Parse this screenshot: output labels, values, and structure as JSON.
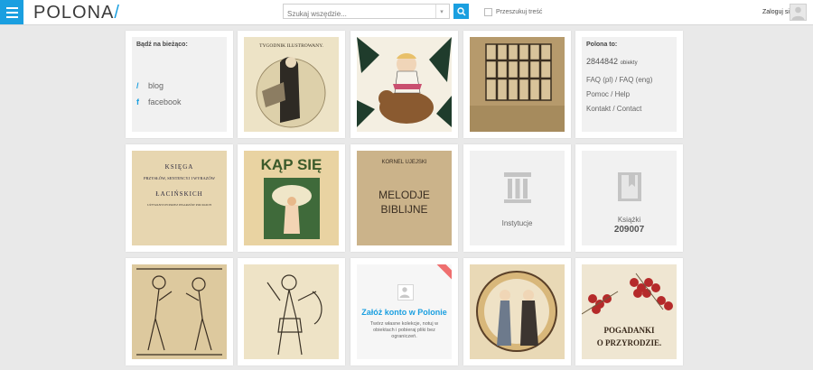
{
  "header": {
    "logo_text": "POLONA",
    "logo_slash": "/",
    "search_placeholder": "Szukaj wszędzie...",
    "fulltext_label": "Przeszukuj treść",
    "login_label": "Zaloguj się"
  },
  "current_panel": {
    "title": "Bądź na bieżąco:",
    "blog_label": "blog",
    "facebook_label": "facebook"
  },
  "polona_panel": {
    "title": "Polona to:",
    "objects_count": "2844842",
    "objects_label": "obiekty",
    "links": [
      "FAQ (pl) / FAQ (eng)",
      "Pomoc / Help",
      "Kontakt / Contact"
    ]
  },
  "categories": {
    "institutions_label": "Instytucje",
    "books_label": "Książki",
    "books_count": "209007"
  },
  "promo": {
    "title": "Załóż konto w Polonie",
    "text": "Twórz własne kolekcje, notuj w obiektach i pobieraj pliki bez ograniczeń."
  },
  "covers": {
    "tygodnik": "TYGODNIK ILUSTROWANY.",
    "ksiega_lines": [
      "KSIĘGA",
      "PRZYSŁÓW, SENTENCYJ I WYRAZÓW",
      "ŁACIŃSKICH",
      "UŻYWANYCH PRZEZ PISARZÓW POLSKICH"
    ],
    "kap_sie": "KĄP SIĘ",
    "kornel_author": "KORNEL UJEJSKI",
    "melodje_line1": "MELODJE",
    "melodje_line2": "BIBLIJNE",
    "pogadanki_line1": "POGADANKI",
    "pogadanki_line2": "O PRZYRODZIE."
  }
}
